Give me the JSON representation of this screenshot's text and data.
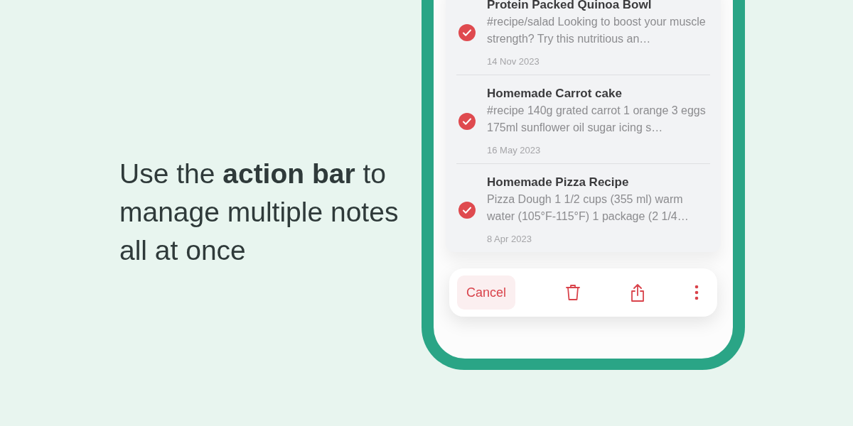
{
  "headline": "Use the **action bar** to manage multiple notes all at once",
  "notes": [
    {
      "title": "Protein Packed Quinoa Bowl",
      "snippet": "#recipe/salad Looking to boost your muscle strength? Try this nutritious an…",
      "date": "14 Nov 2023",
      "selected": true
    },
    {
      "title": "Homemade Carrot cake",
      "snippet": "#recipe 140g grated carrot 1 orange 3 eggs 175ml sunflower oil sugar icing s…",
      "date": "16 May 2023",
      "selected": true
    },
    {
      "title": "Homemade Pizza Recipe",
      "snippet": "Pizza Dough 1 1/2 cups (355 ml) warm water (105°F-115°F) 1 package (2 1/4…",
      "date": "8 Apr 2023",
      "selected": true
    }
  ],
  "action_bar": {
    "cancel": "Cancel"
  }
}
